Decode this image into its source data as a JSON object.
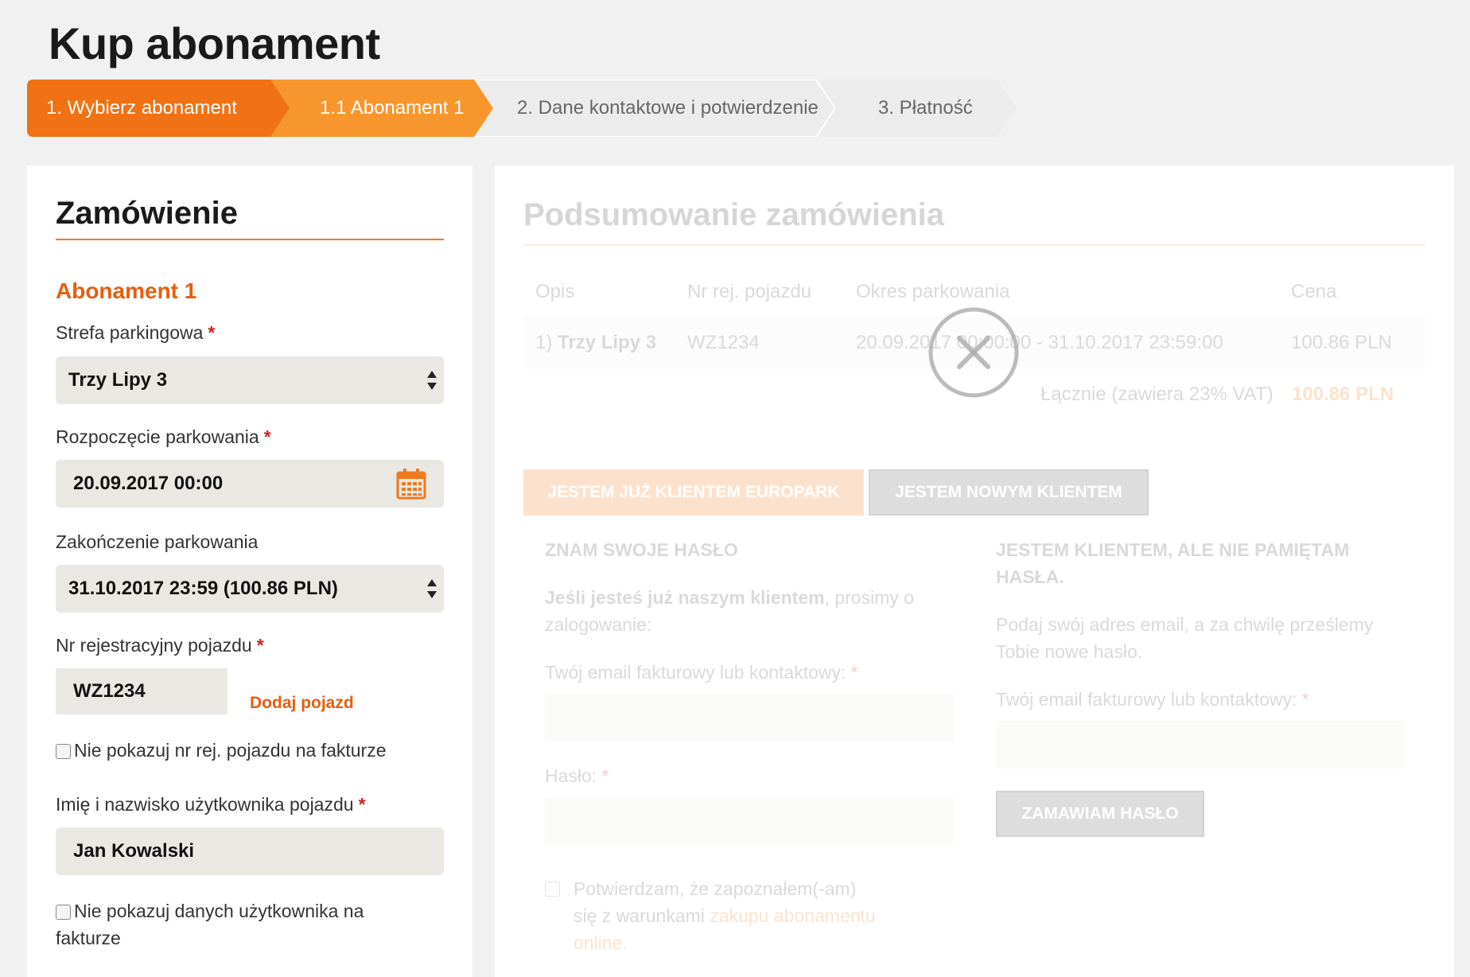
{
  "page": {
    "title": "Kup abonament"
  },
  "steps": [
    {
      "label": "1. Wybierz abonament"
    },
    {
      "label": "1.1 Abonament 1"
    },
    {
      "label": "2. Dane kontaktowe i potwierdzenie"
    },
    {
      "label": "3. Płatność"
    }
  ],
  "order": {
    "title": "Zamówienie",
    "subscription_title": "Abonament 1",
    "zone_label": "Strefa parkingowa",
    "zone_value": "Trzy Lipy 3",
    "start_label": "Rozpoczęcie parkowania",
    "start_value": "20.09.2017 00:00",
    "end_label": "Zakończenie parkowania",
    "end_value": "31.10.2017 23:59 (100.86 PLN)",
    "plate_label": "Nr rejestracyjny pojazdu",
    "plate_value": "WZ1234",
    "add_vehicle": "Dodaj pojazd",
    "hide_plate_label": "Nie pokazuj nr rej. pojazdu na fakturze",
    "user_label": "Imię i nazwisko użytkownika pojazdu",
    "user_value": "Jan Kowalski",
    "hide_user_label": "Nie pokazuj danych użytkownika na fakturze",
    "required_mark": "*"
  },
  "summary": {
    "title": "Podsumowanie zamówienia",
    "headers": {
      "desc": "Opis",
      "plate": "Nr rej. pojazdu",
      "period": "Okres parkowania",
      "price": "Cena"
    },
    "row": {
      "num": "1)",
      "desc": "Trzy Lipy 3",
      "plate": "WZ1234",
      "period": "20.09.2017 00:00:00 - 31.10.2017 23:59:00",
      "price": "100.86 PLN"
    },
    "total_label": "Łącznie (zawiera 23% VAT)",
    "total_value": "100.86 PLN"
  },
  "client_tabs": {
    "existing": "JESTEM JUŻ KLIENTEM EUROPARK",
    "new": "JESTEM NOWYM KLIENTEM"
  },
  "login": {
    "heading": "ZNAM SWOJE HASŁO",
    "intro_bold": "Jeśli jesteś już naszym klientem",
    "intro_rest": ", prosimy o zalogowanie:",
    "email_label": "Twój email fakturowy lub kontaktowy:",
    "password_label": "Hasło:",
    "terms_pre": "Potwierdzam, że zapoznałem(-am) się z warunkami ",
    "terms_link": "zakupu abonamentu online."
  },
  "forgot": {
    "heading": "JESTEM KLIENTEM, ALE NIE PAMIĘTAM HASŁA.",
    "text": "Podaj swój adres email, a za chwilę prześlemy Tobie nowe hasło.",
    "email_label": "Twój email fakturowy lub kontaktowy:",
    "button": "ZAMAWIAM HASŁO"
  },
  "icons": {
    "close": "close-icon",
    "calendar": "calendar-icon",
    "select_arrows": "select-arrows-icon"
  },
  "colors": {
    "accent": "#f07a1e",
    "accent_dark": "#e85d0d",
    "field_bg": "#e9e8e3"
  }
}
